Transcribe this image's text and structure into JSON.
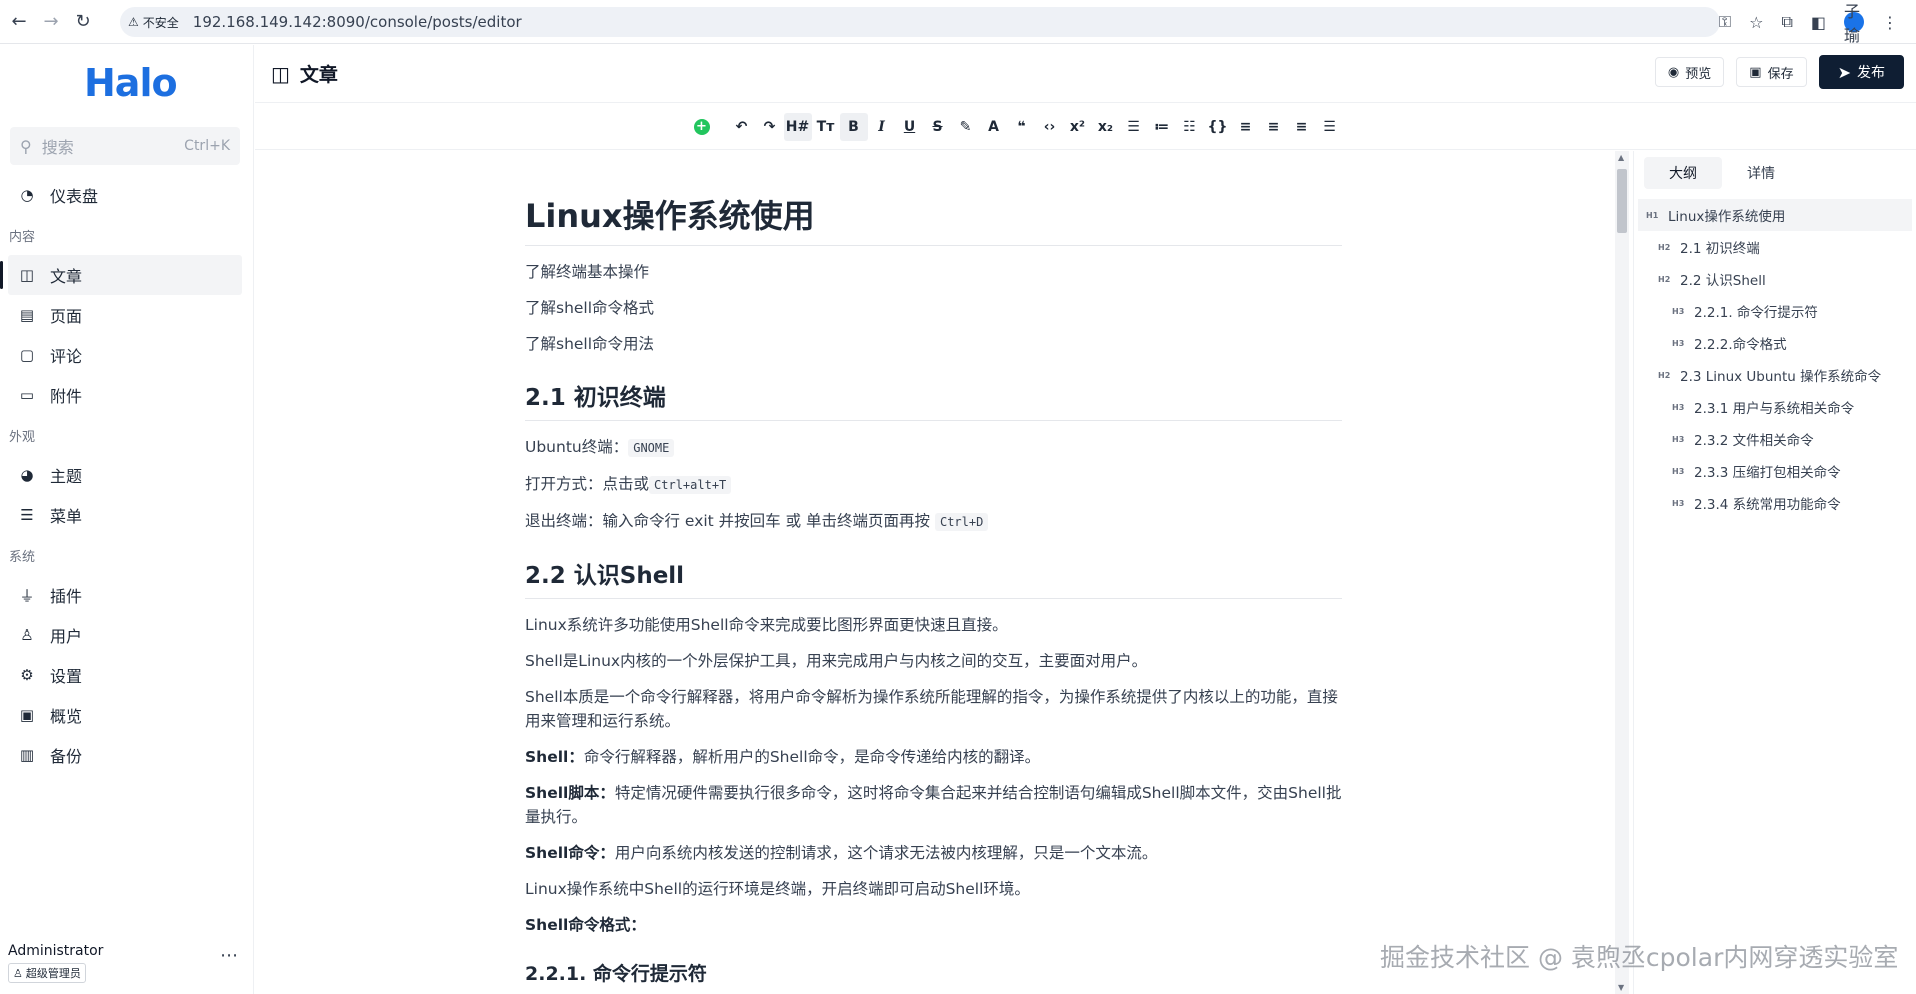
{
  "browser": {
    "insecure_label": "不安全",
    "url": "192.168.149.142:8090/console/posts/editor",
    "avatar_text": "子瑜"
  },
  "sidebar": {
    "logo": "Halo",
    "search_placeholder": "搜索",
    "search_shortcut": "Ctrl+K",
    "dashboard": "仪表盘",
    "groups": {
      "content": "内容",
      "appearance": "外观",
      "system": "系统"
    },
    "items": {
      "posts": "文章",
      "pages": "页面",
      "comments": "评论",
      "attachments": "附件",
      "themes": "主题",
      "menus": "菜单",
      "plugins": "插件",
      "users": "用户",
      "settings": "设置",
      "overview": "概览",
      "backup": "备份"
    },
    "user": {
      "name": "Administrator",
      "role": "超级管理员"
    }
  },
  "header": {
    "title": "文章",
    "preview": "预览",
    "save": "保存",
    "publish": "发布"
  },
  "document": {
    "h1": "Linux操作系统使用",
    "intro": [
      "了解终端基本操作",
      "了解shell命令格式",
      "了解shell命令用法"
    ],
    "s21_title": "2.1 初识终端",
    "s21_l1_text": "Ubuntu终端：",
    "s21_l1_code": "GNOME",
    "s21_l2_text": "打开方式：点击或",
    "s21_l2_code": "Ctrl+alt+T",
    "s21_l3_text": "退出终端：输入命令行 exit 并按回车 或 单击终端页面再按",
    "s21_l3_code": "Ctrl+D",
    "s22_title": "2.2 认识Shell",
    "s22_p1": "Linux系统许多功能使用Shell命令来完成要比图形界面更快速且直接。",
    "s22_p2": "Shell是Linux内核的一个外层保护工具，用来完成用户与内核之间的交互，主要面对用户。",
    "s22_p3": "Shell本质是一个命令行解释器，将用户命令解析为操作系统所能理解的指令，为操作系统提供了内核以上的功能，直接用来管理和运行系统。",
    "s22_p4_b": "Shell：",
    "s22_p4": "命令行解释器，解析用户的Shell命令，是命令传递给内核的翻译。",
    "s22_p5_b": "Shell脚本：",
    "s22_p5": "特定情况硬件需要执行很多命令，这时将命令集合起来并结合控制语句编辑成Shell脚本文件，交由Shell批量执行。",
    "s22_p6_b": "Shell命令：",
    "s22_p6": "用户向系统内核发送的控制请求，这个请求无法被内核理解，只是一个文本流。",
    "s22_p7": "Linux操作系统中Shell的运行环境是终端，开启终端即可启动Shell环境。",
    "s22_p8_b": "Shell命令格式：",
    "s221_title": "2.2.1. 命令行提示符"
  },
  "outline": {
    "tab_outline": "大纲",
    "tab_detail": "详情",
    "items": [
      {
        "level": "H1",
        "text": "Linux操作系统使用"
      },
      {
        "level": "H2",
        "text": "2.1 初识终端"
      },
      {
        "level": "H2",
        "text": "2.2 认识Shell"
      },
      {
        "level": "H3",
        "text": "2.2.1. 命令行提示符"
      },
      {
        "level": "H3",
        "text": "2.2.2.命令格式"
      },
      {
        "level": "H2",
        "text": "2.3 Linux Ubuntu 操作系统命令"
      },
      {
        "level": "H3",
        "text": "2.3.1 用户与系统相关命令"
      },
      {
        "level": "H3",
        "text": "2.3.2 文件相关命令"
      },
      {
        "level": "H3",
        "text": "2.3.3 压缩打包相关命令"
      },
      {
        "level": "H3",
        "text": "2.3.4 系统常用功能命令"
      }
    ]
  },
  "watermark": "掘金技术社区 @ 袁煦丞cpolar内网穿透实验室",
  "colors": {
    "brand": "#1d6fe0",
    "publish_bg": "#0f1e33",
    "add_block": "#22c55e"
  }
}
